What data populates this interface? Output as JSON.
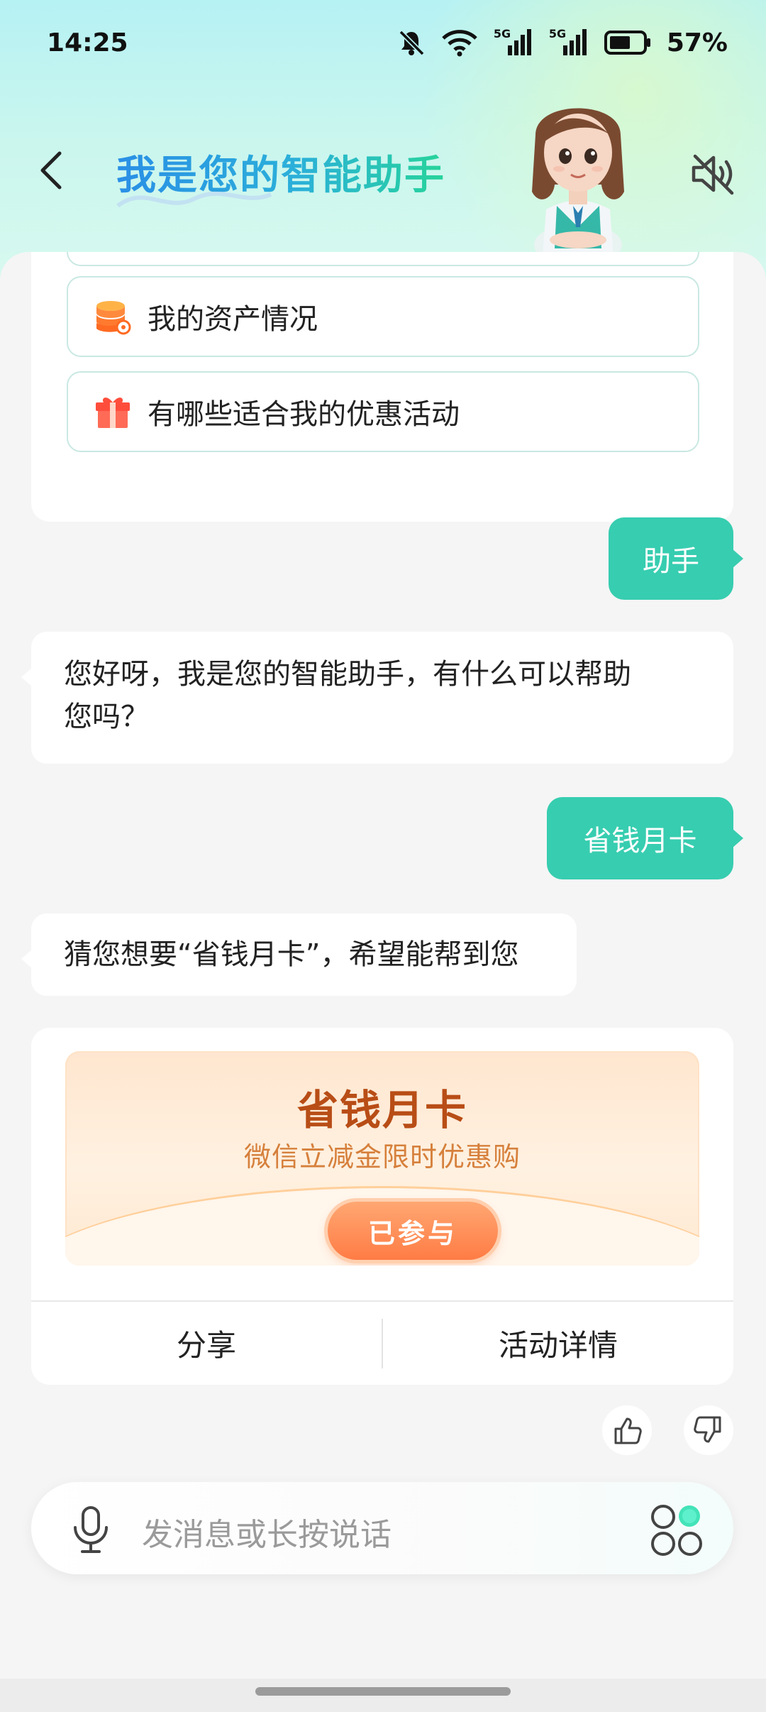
{
  "status_bar": {
    "time": "14:25",
    "network_1": "5G",
    "network_2": "5G",
    "battery_percent": "57%",
    "icons": [
      "bell-off-icon",
      "wifi-icon",
      "signal-5g-icon",
      "signal-5g-icon",
      "battery-icon"
    ]
  },
  "header": {
    "title": "我是您的智能助手",
    "back_icon": "chevron-left-icon",
    "mute_icon": "speaker-muted-icon",
    "avatar": "assistant-avatar"
  },
  "quick_questions": [
    {
      "label": "我的资产情况",
      "icon": "database-icon"
    },
    {
      "label": "有哪些适合我的优惠活动",
      "icon": "gift-icon"
    }
  ],
  "messages": [
    {
      "from": "user",
      "text": "助手"
    },
    {
      "from": "assistant",
      "line1": "您好呀，我是您的智能助手，有什么可以帮助",
      "line2": "您吗？"
    },
    {
      "from": "user",
      "text": "省钱月卡"
    },
    {
      "from": "assistant",
      "text": "猜您想要“省钱月卡”，希望能帮到您"
    }
  ],
  "promo": {
    "title": "省钱月卡",
    "subtitle": "微信立减金限时优惠购",
    "button": "已参与",
    "share": "分享",
    "details": "活动详情"
  },
  "feedback": {
    "like_icon": "thumbs-up-icon",
    "dislike_icon": "thumbs-down-icon"
  },
  "input": {
    "placeholder": "发消息或长按说话",
    "mic_icon": "microphone-icon",
    "apps_icon": "apps-grid-icon"
  },
  "colors": {
    "accent": "#37cdb0",
    "promo_title": "#b84d16",
    "promo_button": "#ff7c45"
  }
}
